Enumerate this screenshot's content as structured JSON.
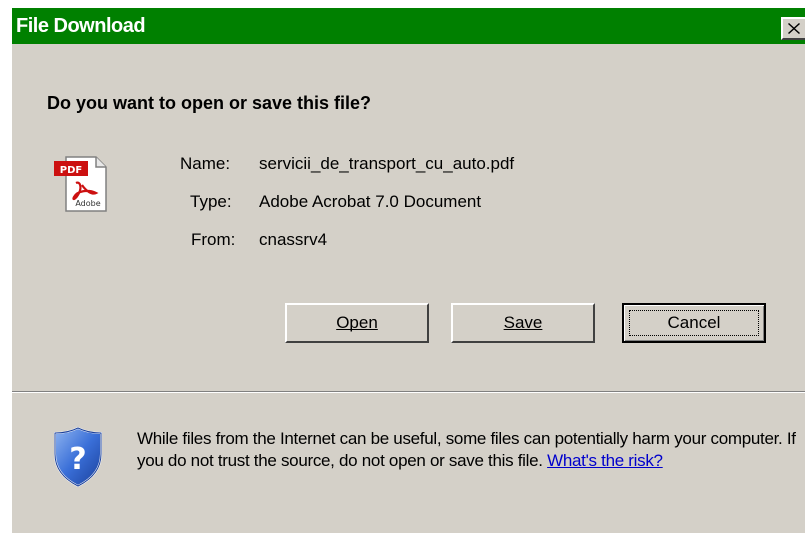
{
  "dialog": {
    "title": "File Download",
    "question": "Do you want to open or save this file?",
    "file": {
      "icon": "pdf-file-icon",
      "name_label": "Name:",
      "name_value": "servicii_de_transport_cu_auto.pdf",
      "type_label": "Type:",
      "type_value": "Adobe Acrobat 7.0 Document",
      "from_label": "From:",
      "from_value": "cnassrv4"
    },
    "buttons": {
      "open": "Open",
      "save": "Save",
      "cancel": "Cancel"
    },
    "warning": {
      "icon": "security-shield-icon",
      "text": "While files from the Internet can be useful, some files can potentially harm your computer. If you do not trust the source, do not open or save this file. ",
      "link": "What's the risk?"
    }
  },
  "colors": {
    "titlebar": "#008000",
    "face": "#d4d0c8",
    "link": "#0000cc"
  }
}
